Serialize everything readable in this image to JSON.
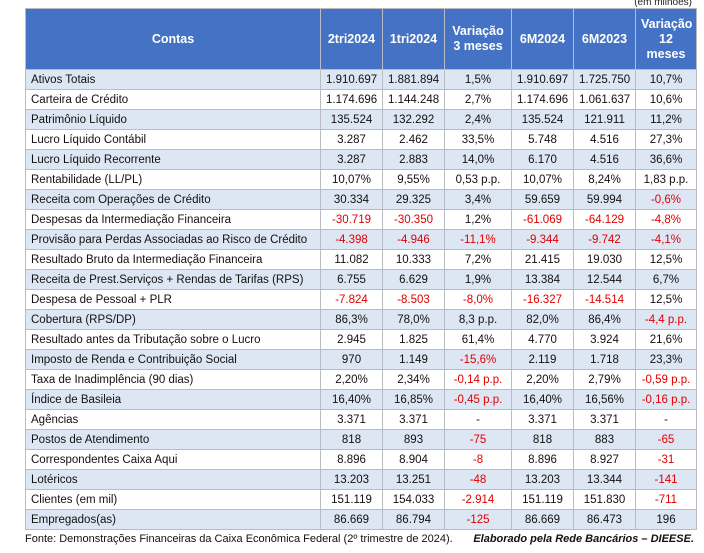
{
  "unit_note": "(em milhões)",
  "headers": [
    "Contas",
    "2tri2024",
    "1tri2024",
    "Variação 3 meses",
    "6M2024",
    "6M2023",
    "Variação 12 meses"
  ],
  "rows": [
    [
      "Ativos Totais",
      "1.910.697",
      "1.881.894",
      "1,5%",
      "1.910.697",
      "1.725.750",
      "10,7%"
    ],
    [
      "Carteira de Crédito",
      "1.174.696",
      "1.144.248",
      "2,7%",
      "1.174.696",
      "1.061.637",
      "10,6%"
    ],
    [
      "Patrimônio Líquido",
      "135.524",
      "132.292",
      "2,4%",
      "135.524",
      "121.911",
      "11,2%"
    ],
    [
      "Lucro Líquido Contábil",
      "3.287",
      "2.462",
      "33,5%",
      "5.748",
      "4.516",
      "27,3%"
    ],
    [
      "Lucro Líquido Recorrente",
      "3.287",
      "2.883",
      "14,0%",
      "6.170",
      "4.516",
      "36,6%"
    ],
    [
      "Rentabilidade (LL/PL)",
      "10,07%",
      "9,55%",
      "0,53 p.p.",
      "10,07%",
      "8,24%",
      "1,83 p.p."
    ],
    [
      "Receita com Operações de Crédito",
      "30.334",
      "29.325",
      "3,4%",
      "59.659",
      "59.994",
      "-0,6%"
    ],
    [
      "Despesas da Intermediação Financeira",
      "-30.719",
      "-30.350",
      "1,2%",
      "-61.069",
      "-64.129",
      "-4,8%"
    ],
    [
      "Provisão para Perdas Associadas ao Risco de Crédito",
      "-4.398",
      "-4.946",
      "-11,1%",
      "-9.344",
      "-9.742",
      "-4,1%"
    ],
    [
      "Resultado Bruto da Intermediação Financeira",
      "11.082",
      "10.333",
      "7,2%",
      "21.415",
      "19.030",
      "12,5%"
    ],
    [
      "Receita de Prest.Serviços + Rendas de Tarifas (RPS)",
      "6.755",
      "6.629",
      "1,9%",
      "13.384",
      "12.544",
      "6,7%"
    ],
    [
      "Despesa de Pessoal + PLR",
      "-7.824",
      "-8.503",
      "-8,0%",
      "-16.327",
      "-14.514",
      "12,5%"
    ],
    [
      "Cobertura (RPS/DP)",
      "86,3%",
      "78,0%",
      "8,3 p.p.",
      "82,0%",
      "86,4%",
      "-4,4 p.p."
    ],
    [
      "Resultado antes da Tributação sobre o Lucro",
      "2.945",
      "1.825",
      "61,4%",
      "4.770",
      "3.924",
      "21,6%"
    ],
    [
      "Imposto de Renda e Contribuição Social",
      "970",
      "1.149",
      "-15,6%",
      "2.119",
      "1.718",
      "23,3%"
    ],
    [
      "Taxa de Inadimplência (90 dias)",
      "2,20%",
      "2,34%",
      "-0,14 p.p.",
      "2,20%",
      "2,79%",
      "-0,59 p.p."
    ],
    [
      "Índice de Basileia",
      "16,40%",
      "16,85%",
      "-0,45 p.p.",
      "16,40%",
      "16,56%",
      "-0,16 p.p."
    ],
    [
      "Agências",
      "3.371",
      "3.371",
      "-",
      "3.371",
      "3.371",
      "-"
    ],
    [
      "Postos de Atendimento",
      "818",
      "893",
      "-75",
      "818",
      "883",
      "-65"
    ],
    [
      "Correspondentes Caixa Aqui",
      "8.896",
      "8.904",
      "-8",
      "8.896",
      "8.927",
      "-31"
    ],
    [
      "Lotéricos",
      "13.203",
      "13.251",
      "-48",
      "13.203",
      "13.344",
      "-141"
    ],
    [
      "Clientes (em mil)",
      "151.119",
      "154.033",
      "-2.914",
      "151.119",
      "151.830",
      "-711"
    ],
    [
      "Empregados(as)",
      "86.669",
      "86.794",
      "-125",
      "86.669",
      "86.473",
      "196"
    ]
  ],
  "negative_color": "#e00000",
  "header_color": "#4472c4",
  "stripe_color": "#dde6f3",
  "footer": {
    "source": "Fonte: Demonstrações Financeiras da Caixa Econômica Federal (2º trimestre de 2024).",
    "credit": "Elaborado pela Rede Bancários – DIEESE."
  }
}
